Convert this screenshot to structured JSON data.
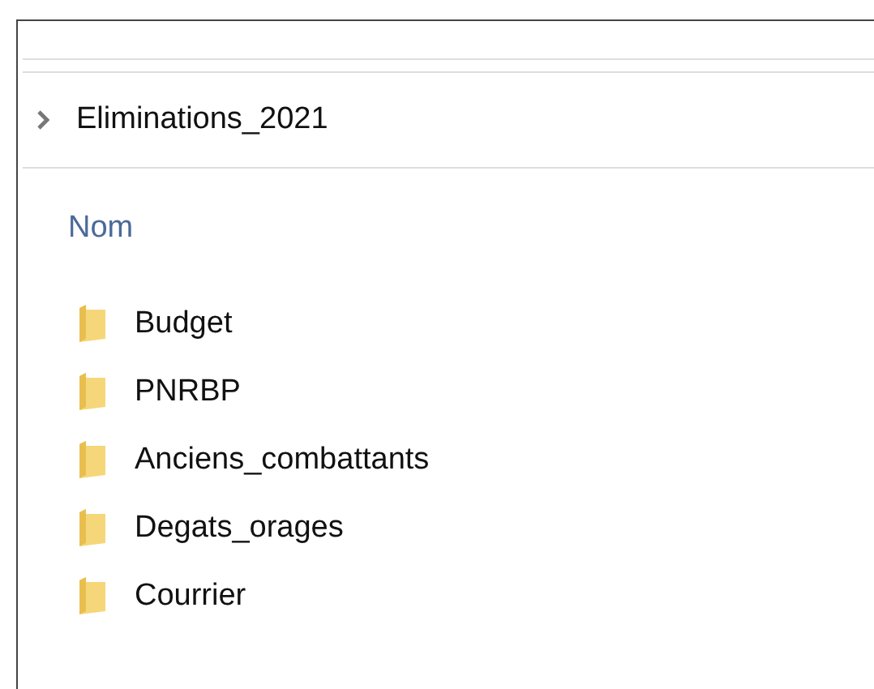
{
  "breadcrumb": {
    "folder": "Eliminations_2021"
  },
  "column_header": "Nom",
  "folders": [
    {
      "name": "Budget"
    },
    {
      "name": "PNRBP"
    },
    {
      "name": "Anciens_combattants"
    },
    {
      "name": "Degats_orages"
    },
    {
      "name": "Courrier"
    }
  ]
}
